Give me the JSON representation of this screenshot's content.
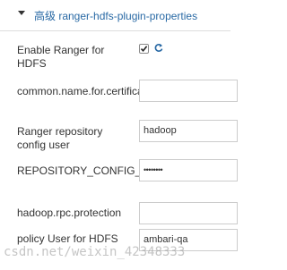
{
  "header": {
    "title": "高级 ranger-hdfs-plugin-properties"
  },
  "fields": {
    "enable_ranger": {
      "label": "Enable Ranger for HDFS",
      "checked": true
    },
    "common_name": {
      "label": "common.name.for.certificate",
      "value": ""
    },
    "repo_user": {
      "label": "Ranger repository config user",
      "value": "hadoop"
    },
    "repo_password": {
      "label": "REPOSITORY_CONFIG_PASSWORD",
      "value": "••••••••"
    },
    "rpc_protection": {
      "label": "hadoop.rpc.protection",
      "value": ""
    },
    "policy_user": {
      "label": "policy User for HDFS",
      "value": "ambari-qa"
    }
  },
  "watermark": "csdn.net/weixin_42348333",
  "colors": {
    "header_title": "#2a6aa5",
    "refresh_icon": "#2a6aa5"
  }
}
